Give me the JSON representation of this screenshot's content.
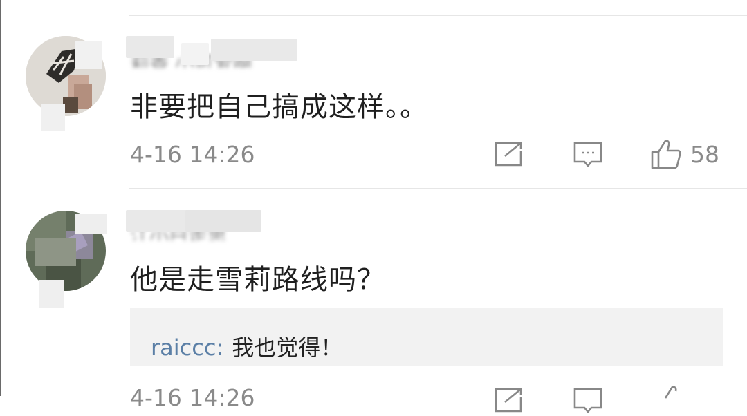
{
  "comments": [
    {
      "username": "莉香 小可爱啊",
      "text": "非要把自己搞成这样。。",
      "time": "4-16 14:26",
      "likes": "58",
      "avatar_colors": [
        "#d8d3cd",
        "#2e2c2a",
        "#b08f7c"
      ]
    },
    {
      "username": "江小白走思",
      "text": "他是走雪莉路线吗？",
      "time": "4-16 14:26",
      "avatar_colors": [
        "#6e7866",
        "#8f8a9d",
        "#45503f"
      ],
      "reply": {
        "user": "raiccc",
        "separator": ":",
        "text": "我也觉得！"
      }
    }
  ],
  "icons": {
    "share": "share-icon",
    "comment": "comment-icon",
    "like": "like-icon"
  },
  "colors": {
    "link": "#5b7fa6",
    "meta": "#8a8a8a",
    "reply_bg": "#f2f2f2"
  }
}
